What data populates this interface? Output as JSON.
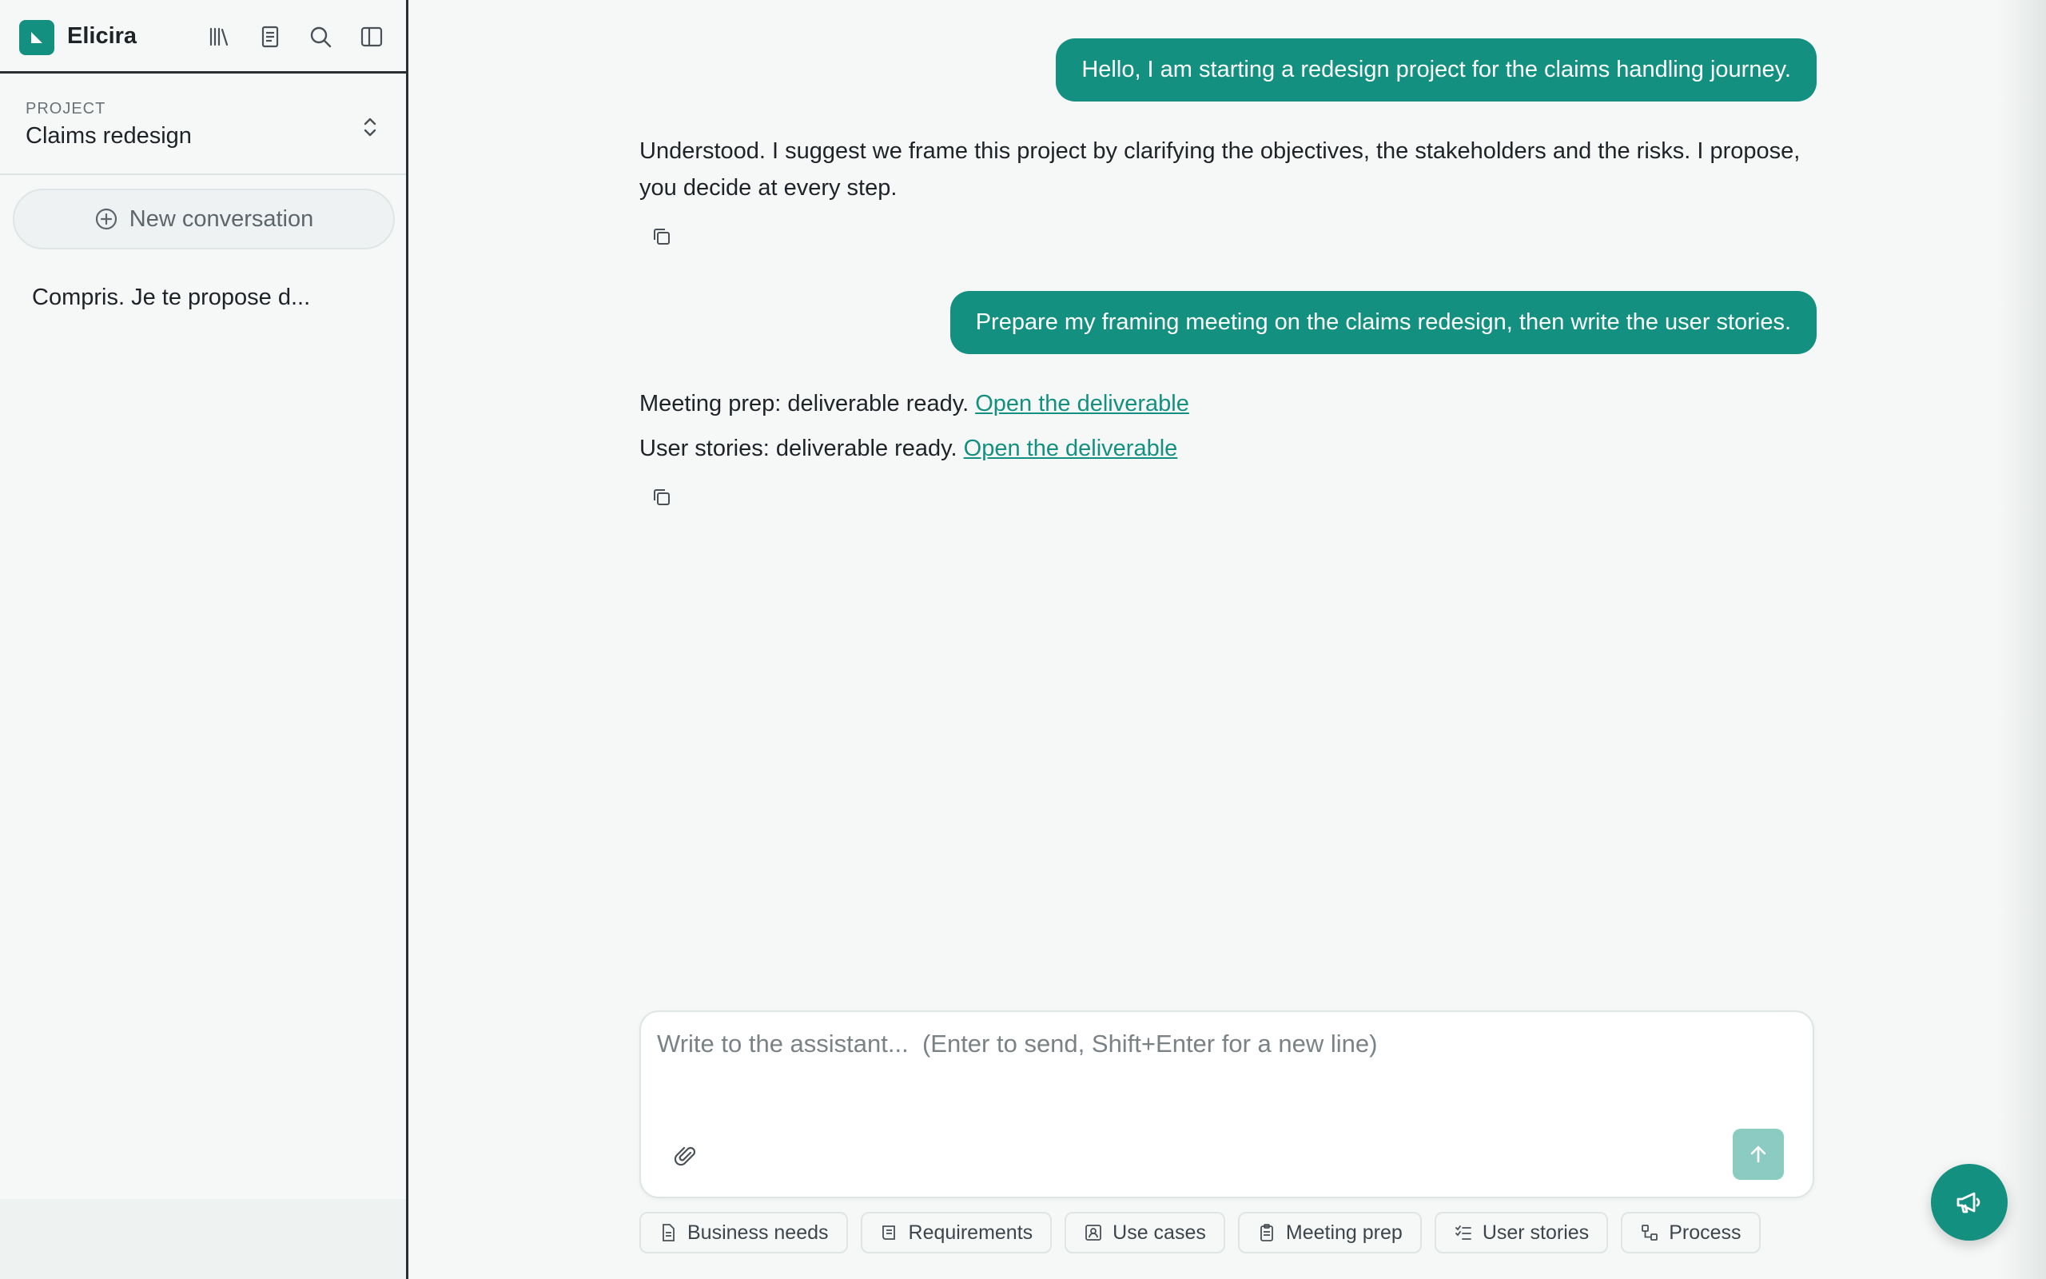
{
  "app": {
    "title": "Elicira",
    "brand_color": "#13907f"
  },
  "sidebar": {
    "icons": [
      "library-icon",
      "document-icon",
      "search-icon",
      "sidebar-toggle-icon"
    ],
    "project": {
      "label": "PROJECT",
      "name": "Claims redesign"
    },
    "new_conversation_label": "New conversation",
    "conversations": [
      {
        "title": "Compris. Je te propose d..."
      }
    ]
  },
  "chat": {
    "messages": [
      {
        "role": "user",
        "text": "Hello, I am starting a redesign project for the claims handling journey."
      },
      {
        "role": "assistant",
        "text": "Understood. I suggest we frame this project by clarifying the objectives, the stakeholders and the risks. I propose, you decide at every step."
      },
      {
        "role": "user",
        "text": "Prepare my framing meeting on the claims redesign, then write the user stories."
      },
      {
        "role": "assistant",
        "lines": [
          {
            "prefix": "Meeting prep: deliverable ready.",
            "link": "Open the deliverable"
          },
          {
            "prefix": "User stories: deliverable ready.",
            "link": "Open the deliverable"
          }
        ]
      }
    ]
  },
  "composer": {
    "placeholder": "Write to the assistant...  (Enter to send, Shift+Enter for a new line)"
  },
  "chips": [
    {
      "label": "Business needs",
      "icon": "document-icon"
    },
    {
      "label": "Requirements",
      "icon": "scroll-icon"
    },
    {
      "label": "Use cases",
      "icon": "user-card-icon"
    },
    {
      "label": "Meeting prep",
      "icon": "clipboard-icon"
    },
    {
      "label": "User stories",
      "icon": "checklist-icon"
    },
    {
      "label": "Process",
      "icon": "flow-icon"
    }
  ]
}
